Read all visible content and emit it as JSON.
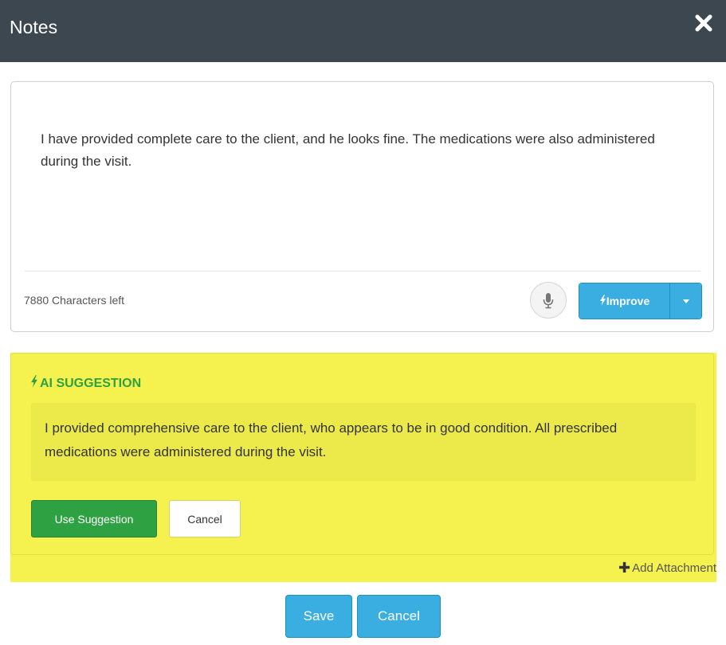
{
  "dialog": {
    "title": "Notes",
    "close_icon": "close-icon"
  },
  "note": {
    "text": "I have provided complete care to the client, and he looks fine. The medications were also administered during the visit.",
    "characters_left": "7880 Characters left",
    "mic_icon": "microphone-icon",
    "improve_label": "Improve",
    "improve_icon": "lightning-bolt-icon"
  },
  "ai_suggestion": {
    "heading": "AI SUGGESTION",
    "heading_icon": "lightning-bolt-icon",
    "text": "I provided comprehensive care to the client, who appears to be in good condition. All prescribed medications were administered during the visit.",
    "use_label": "Use Suggestion",
    "cancel_label": "Cancel",
    "highlight_color": "#f5f24f",
    "accent_color": "#2ea142"
  },
  "attachment": {
    "label": "Add Attachment",
    "icon": "plus-icon"
  },
  "footer": {
    "save_label": "Save",
    "cancel_label": "Cancel",
    "button_color": "#3aaee0"
  }
}
